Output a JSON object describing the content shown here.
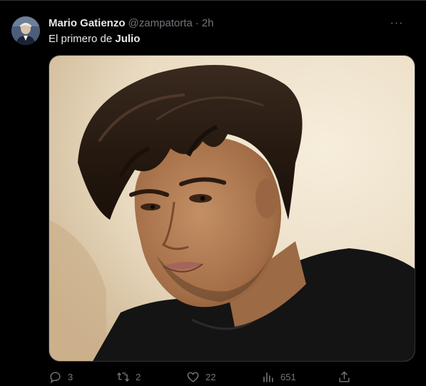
{
  "tweet": {
    "author_name": "Mario Gatienzo",
    "author_handle": "@zampatorta",
    "separator": "·",
    "timestamp": "2h",
    "more_label": "···",
    "text_prefix": "El primero de ",
    "text_bold": "Julio",
    "media_alt": "Portrait of a man with dark tousled hair wearing a black t-shirt"
  },
  "actions": {
    "replies": "3",
    "reposts": "2",
    "likes": "22",
    "views": "651"
  },
  "icons": {
    "reply": "reply-icon",
    "repost": "repost-icon",
    "like": "heart-icon",
    "views": "views-chart-icon",
    "share": "share-icon",
    "more": "more-icon"
  },
  "colors": {
    "background": "#000000",
    "text_primary": "#e7e9ea",
    "text_secondary": "#71767b",
    "border": "#2f3336"
  }
}
